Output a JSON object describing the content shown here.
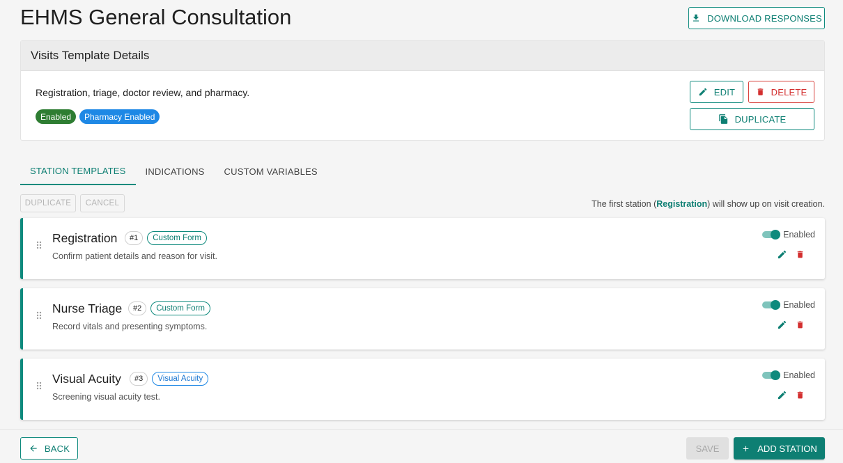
{
  "page": {
    "title": "EHMS General Consultation",
    "download_label": "DOWNLOAD RESPONSES"
  },
  "details": {
    "header": "Visits Template Details",
    "description": "Registration, triage, doctor review, and pharmacy.",
    "chips": [
      "Enabled",
      "Pharmacy Enabled"
    ],
    "edit_label": "EDIT",
    "delete_label": "DELETE",
    "duplicate_label": "DUPLICATE"
  },
  "tabs": [
    {
      "label": "STATION TEMPLATES",
      "active": true
    },
    {
      "label": "INDICATIONS",
      "active": false
    },
    {
      "label": "CUSTOM VARIABLES",
      "active": false
    }
  ],
  "toolbar": {
    "duplicate_label": "DUPLICATE",
    "cancel_label": "CANCEL",
    "note_prefix": "The first station (",
    "note_station": "Registration",
    "note_suffix": ") will show up on visit creation."
  },
  "stations": [
    {
      "name": "Registration",
      "number": "#1",
      "type": "Custom Form",
      "description": "Confirm patient details and reason for visit.",
      "toggle_label": "Enabled",
      "enabled": true
    },
    {
      "name": "Nurse Triage",
      "number": "#2",
      "type": "Custom Form",
      "description": "Record vitals and presenting symptoms.",
      "toggle_label": "Enabled",
      "enabled": true
    },
    {
      "name": "Visual Acuity",
      "number": "#3",
      "type": "Visual Acuity",
      "description": "Screening visual acuity test.",
      "toggle_label": "Enabled",
      "enabled": true
    }
  ],
  "footer": {
    "back_label": "BACK",
    "save_label": "SAVE",
    "add_label": "ADD STATION"
  },
  "colors": {
    "primary": "#0e7f73",
    "danger": "#d32f2f",
    "chip_enabled": "#2e7d32",
    "chip_pharmacy": "#1e88e5"
  },
  "icons": [
    "download-icon",
    "pencil-icon",
    "trash-icon",
    "copy-icon",
    "drag-handle-icon",
    "arrow-left-icon",
    "plus-icon"
  ]
}
